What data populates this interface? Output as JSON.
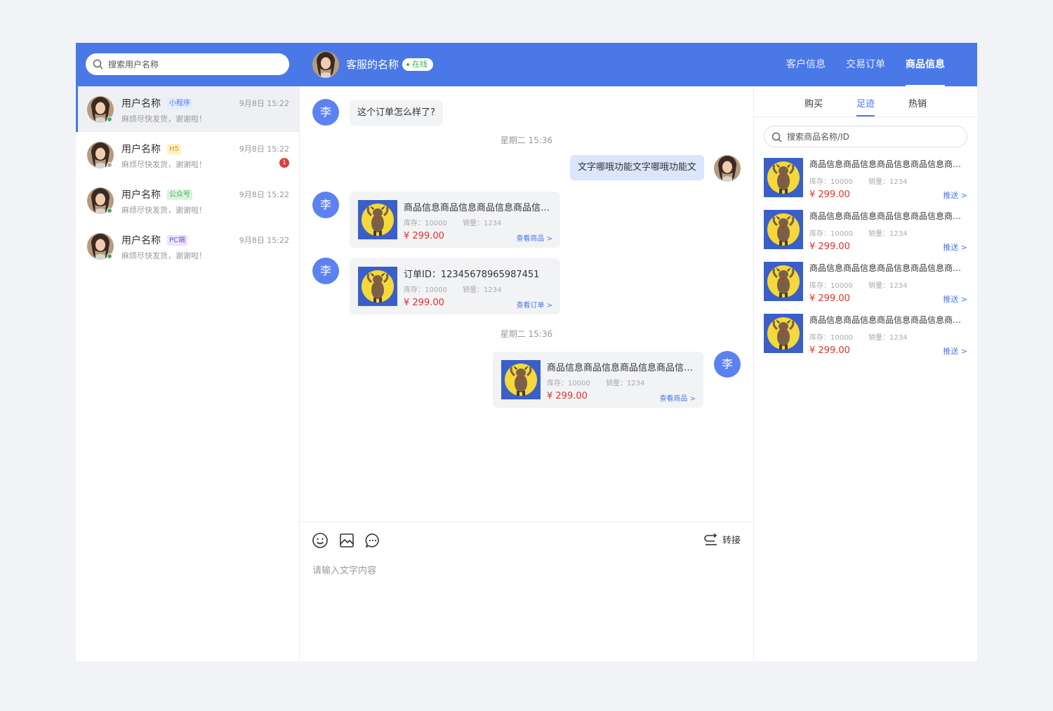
{
  "search": {
    "placeholder": "搜索用户名称"
  },
  "agent": {
    "name": "客服的名称",
    "status": "在线"
  },
  "top_tabs": [
    {
      "label": "客户信息"
    },
    {
      "label": "交易订单"
    },
    {
      "label": "商品信息"
    }
  ],
  "conversations": [
    {
      "name": "用户名称",
      "tag": "小程序",
      "preview": "麻烦尽快发货，谢谢啦！",
      "time": "9月8日 15:22",
      "unread": ""
    },
    {
      "name": "用户名称",
      "tag": "H5",
      "preview": "麻烦尽快发货，谢谢啦！",
      "time": "9月8日 15:22",
      "unread": "1"
    },
    {
      "name": "用户名称",
      "tag": "公众号",
      "preview": "麻烦尽快发货，谢谢啦！",
      "time": "9月8日 15:22",
      "unread": ""
    },
    {
      "name": "用户名称",
      "tag": "PC端",
      "preview": "麻烦尽快发货，谢谢啦！",
      "time": "9月8日 15:22",
      "unread": ""
    }
  ],
  "chat": {
    "user_initial": "李",
    "msg1": "这个订单怎么样了?",
    "time1": "星期二 15:36",
    "msg2": "文字哪哦功能文字哪哦功能文",
    "card1": {
      "title": "商品信息商品信息商品信息商品信息商品信息",
      "stock": "库存：10000",
      "sales": "销量：1234",
      "price": "¥ 299.00",
      "link": "查看商品 >"
    },
    "card2": {
      "title": "订单ID：12345678965987451",
      "stock": "库存：10000",
      "sales": "销量：1234",
      "price": "¥ 299.00",
      "link": "查看订单 >"
    },
    "time2": "星期二 15:36",
    "card3": {
      "title": "商品信息商品信息商品信息商品信息商品信息",
      "stock": "库存：10000",
      "sales": "销量：1234",
      "price": "¥ 299.00",
      "link": "查看商品 >"
    }
  },
  "composer": {
    "transfer": "转接",
    "placeholder": "请输入文字内容"
  },
  "right_tabs": [
    {
      "label": "购买"
    },
    {
      "label": "足迹"
    },
    {
      "label": "热销"
    }
  ],
  "right_search": {
    "placeholder": "搜索商品名称/ID"
  },
  "products": [
    {
      "title": "商品信息商品信息商品信息商品信息商品信息",
      "stock": "库存：10000",
      "sales": "销量：1234",
      "price": "¥ 299.00",
      "push": "推送 >"
    },
    {
      "title": "商品信息商品信息商品信息商品信息商品信息",
      "stock": "库存：10000",
      "sales": "销量：1234",
      "price": "¥ 299.00",
      "push": "推送 >"
    },
    {
      "title": "商品信息商品信息商品信息商品信息商品信息",
      "stock": "库存：10000",
      "sales": "销量：1234",
      "price": "¥ 299.00",
      "push": "推送 >"
    },
    {
      "title": "商品信息商品信息商品信息商品信息商品信息",
      "stock": "库存：10000",
      "sales": "销量：1234",
      "price": "¥ 299.00",
      "push": "推送 >"
    }
  ],
  "colors": {
    "brand": "#4a78e6",
    "price": "#e0322b",
    "online": "#3eb35b",
    "unread": "#d9403a"
  }
}
